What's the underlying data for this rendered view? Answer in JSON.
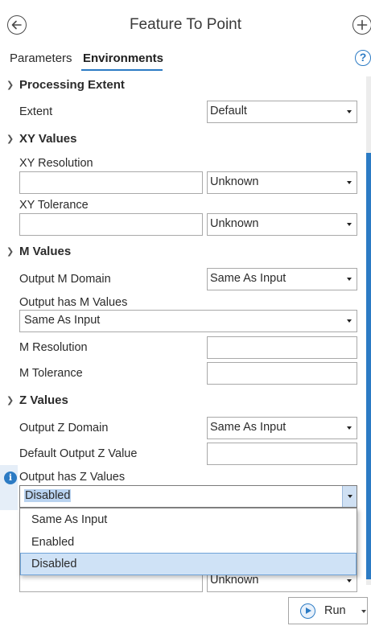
{
  "header": {
    "title": "Feature To Point"
  },
  "tabs": {
    "parameters": "Parameters",
    "environments": "Environments",
    "help": "?"
  },
  "sections": {
    "processing_extent": {
      "title": "Processing Extent",
      "extent_label": "Extent",
      "extent_value": "Default"
    },
    "xy_values": {
      "title": "XY Values",
      "resolution_label": "XY Resolution",
      "resolution_value": "",
      "resolution_unit": "Unknown",
      "tolerance_label": "XY Tolerance",
      "tolerance_value": "",
      "tolerance_unit": "Unknown"
    },
    "m_values": {
      "title": "M Values",
      "output_domain_label": "Output M Domain",
      "output_domain_value": "Same As Input",
      "has_m_label": "Output has M Values",
      "has_m_value": "Same As Input",
      "resolution_label": "M Resolution",
      "resolution_value": "",
      "tolerance_label": "M Tolerance",
      "tolerance_value": ""
    },
    "z_values": {
      "title": "Z Values",
      "output_domain_label": "Output Z Domain",
      "output_domain_value": "Same As Input",
      "default_z_label": "Default Output Z Value",
      "default_z_value": "",
      "has_z_label": "Output has Z Values",
      "has_z_value": "Disabled",
      "has_z_options": [
        "Same As Input",
        "Enabled",
        "Disabled"
      ],
      "hidden_row_unit": "Unknown"
    }
  },
  "footer": {
    "run_label": "Run"
  },
  "colors": {
    "accent": "#2c7bc4",
    "highlight": "#cfe2f6",
    "selection": "#b9d3f0"
  },
  "icons": {
    "back": "back-arrow-circle-icon",
    "add": "plus-circle-icon",
    "help": "question-circle-icon",
    "info": "info-circle-icon",
    "run": "play-circle-icon"
  }
}
